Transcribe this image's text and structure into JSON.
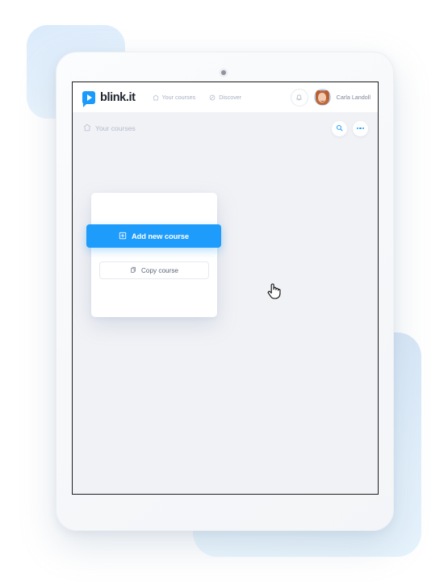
{
  "app": {
    "brand_name": "blink.it",
    "brand_color": "#1a9bfc",
    "page_background": "#f1f2f6"
  },
  "topbar": {
    "logo_icon": "play-bubble-icon",
    "nav": [
      {
        "label": "Your courses",
        "icon": "home-icon"
      },
      {
        "label": "Discover",
        "icon": "compass-icon"
      }
    ],
    "notifications_icon": "bell-icon",
    "avatar_name": "avatar",
    "user_name": "Carla Landoll"
  },
  "breadcrumb": {
    "icon": "home-icon",
    "label": "Your courses",
    "search_icon": "search-icon",
    "more_icon": "more-dots-icon"
  },
  "dropdown": {
    "add_new_course": {
      "label": "Add new course",
      "icon": "square-plus-icon",
      "color": "#1e9cfb",
      "state": "hovered"
    },
    "copy_course": {
      "label": "Copy course",
      "icon": "copy-icon"
    }
  },
  "cursor": {
    "icon": "pointing-hand-cursor"
  }
}
